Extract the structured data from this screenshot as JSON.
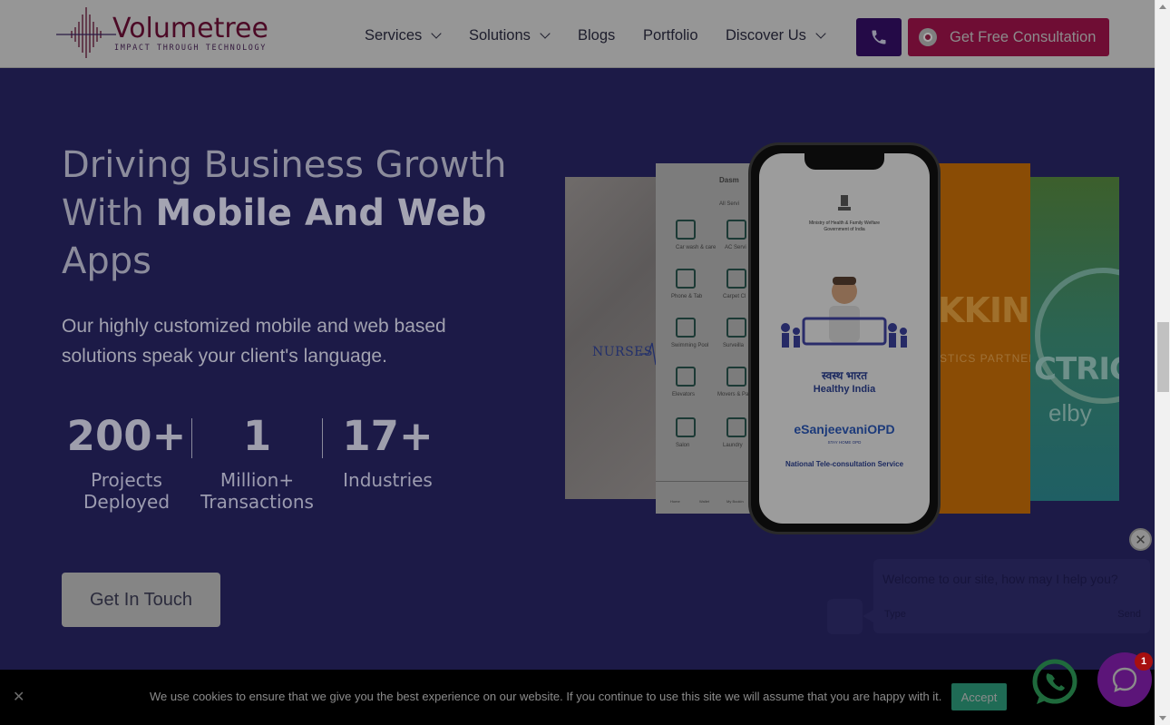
{
  "brand": {
    "name": "Volumetree",
    "tagline": "IMPACT THROUGH TECHNOLOGY"
  },
  "nav": {
    "items": [
      {
        "label": "Services",
        "has_dropdown": true
      },
      {
        "label": "Solutions",
        "has_dropdown": true
      },
      {
        "label": "Blogs",
        "has_dropdown": false
      },
      {
        "label": "Portfolio",
        "has_dropdown": false
      },
      {
        "label": "Discover Us",
        "has_dropdown": true
      }
    ],
    "phone_icon": "phone-icon",
    "cta_label": "Get Free Consultation"
  },
  "hero": {
    "title_plain_1": "Driving Business Growth",
    "title_plain_2": "With ",
    "title_bold": "Mobile And Web",
    "title_plain_3": "Apps",
    "subtitle": "Our highly customized mobile and web based solutions speak your client's language.",
    "stats": [
      {
        "value": "200+",
        "label_1": "Projects",
        "label_2": "Deployed"
      },
      {
        "value": "1",
        "label_1": "Million+",
        "label_2": "Transactions"
      },
      {
        "value": "17+",
        "label_1": "Industries",
        "label_2": ""
      }
    ],
    "cta": "Get In Touch"
  },
  "mockup": {
    "nurse_card_text": "NURSES",
    "phone_screen": {
      "ministry_1": "Ministry of Health & Family Welfare",
      "ministry_2": "Government of India",
      "hindi": "स्वस्थ भारत",
      "healthy": "Healthy India",
      "brand": "eSanjeevaniOPD",
      "brand_sub": "STAY HOME OPD",
      "service": "National Tele-consultation Service"
    },
    "app_card": {
      "location": "Dasm",
      "all_services": "All Servi",
      "items": [
        "Car wash & care",
        "AC Servi",
        "Phone & Tab",
        "Carpet Cl",
        "Swimming Pool",
        "Surveilla",
        "Elevators",
        "Movers & Pa",
        "Salon",
        "Laundry"
      ],
      "tabs": [
        "Home",
        "Wallet",
        "My Bookin"
      ]
    },
    "orange_card": {
      "big": "KKIN",
      "small": "STICS PARTNER"
    },
    "teal_card": {
      "big": "CTRIC",
      "small": "elby"
    }
  },
  "chat": {
    "message": "Welcome to our site, how may I help you?",
    "reply_placeholder": "Type",
    "send_label": "Send"
  },
  "cookie": {
    "text": "We use cookies to ensure that we give you the best experience on our website. If you continue to use this site we will assume that you are happy with it.",
    "accept": "Accept"
  },
  "messenger_badge": "1",
  "colors": {
    "overlay_bg": "#1c1a47",
    "header_bg": "#969696",
    "consult_btn": "#6f0d34",
    "phone_btn": "#240a47",
    "accept_btn": "#1f6b55",
    "messenger": "#5c1579"
  }
}
